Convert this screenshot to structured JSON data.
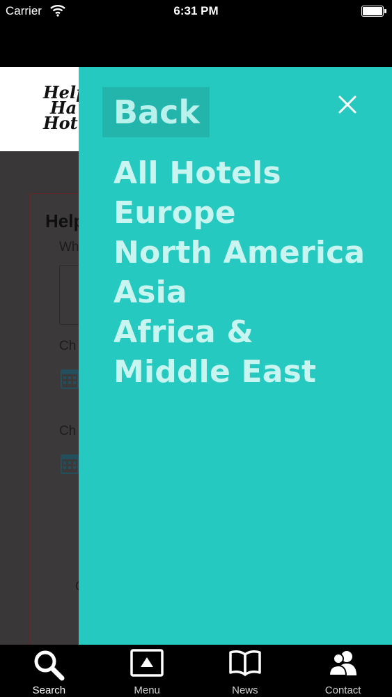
{
  "status_bar": {
    "carrier": "Carrier",
    "time": "6:31 PM"
  },
  "background_page": {
    "logo_lines": [
      "Help",
      "Ha",
      "Hot"
    ],
    "form_title": "Help",
    "labels": [
      "Wh",
      "Ch",
      "Ch",
      "C"
    ]
  },
  "menu": {
    "back_label": "Back",
    "items": [
      {
        "label": "All Hotels"
      },
      {
        "label": "Europe"
      },
      {
        "label": "North America"
      },
      {
        "label": "Asia"
      },
      {
        "label": "Africa & Middle East"
      }
    ],
    "colors": {
      "background": "#26c9bf",
      "back_button": "#23b4ab",
      "text": "#c8f5f0"
    }
  },
  "tab_bar": {
    "tabs": [
      {
        "label": "Search",
        "icon": "search-icon",
        "active": true
      },
      {
        "label": "Menu",
        "icon": "menu-icon",
        "active": false
      },
      {
        "label": "News",
        "icon": "news-icon",
        "active": false
      },
      {
        "label": "Contact",
        "icon": "contact-icon",
        "active": false
      }
    ]
  }
}
